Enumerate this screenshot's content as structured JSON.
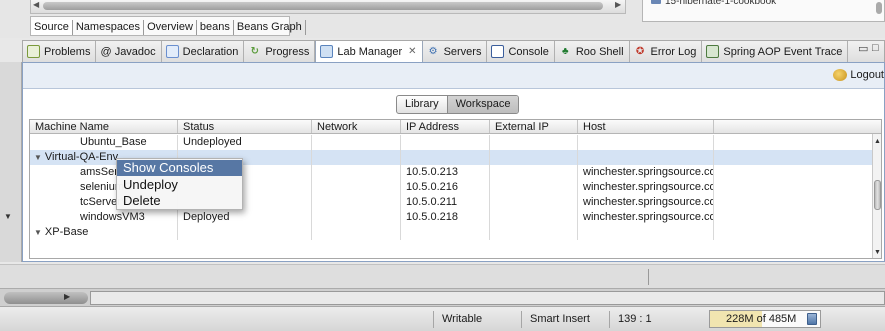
{
  "editor_tabs": {
    "items": [
      "Source",
      "Namespaces",
      "Overview",
      "beans",
      "Beans Graph"
    ],
    "active": "Source"
  },
  "outline": {
    "item": "15-hibernate-1-cookbook"
  },
  "views": {
    "tabs": [
      {
        "label": "Problems",
        "icon": "problems-icon"
      },
      {
        "label": "@ Javadoc",
        "icon": "javadoc-icon"
      },
      {
        "label": "Declaration",
        "icon": "declaration-icon"
      },
      {
        "label": "Progress",
        "icon": "progress-icon"
      },
      {
        "label": "Lab Manager",
        "icon": "lab-manager-icon",
        "active": true,
        "close": "✕"
      },
      {
        "label": "Servers",
        "icon": "servers-icon"
      },
      {
        "label": "Console",
        "icon": "console-icon"
      },
      {
        "label": "Roo Shell",
        "icon": "roo-shell-icon"
      },
      {
        "label": "Error Log",
        "icon": "error-log-icon"
      },
      {
        "label": "Spring AOP Event Trace",
        "icon": "spring-aop-icon"
      }
    ]
  },
  "lab_manager": {
    "logout_label": "Logout",
    "switcher": {
      "library": "Library",
      "workspace": "Workspace",
      "selected": "Workspace"
    },
    "columns": [
      "Machine Name",
      "Status",
      "Network",
      "IP Address",
      "External IP",
      "Host"
    ],
    "rows": [
      {
        "name": "Ubuntu_Base",
        "status": "Undeployed",
        "network": "",
        "ip": "",
        "external_ip": "",
        "host": ""
      },
      {
        "name": "Virtual-QA-Env",
        "group": true,
        "status": "",
        "network": "",
        "ip": "",
        "external_ip": "",
        "host": ""
      },
      {
        "name": "amsServer",
        "status": "",
        "network": "",
        "ip": "10.5.0.213",
        "external_ip": "",
        "host": "winchester.springsource.co"
      },
      {
        "name": "seleniumG",
        "status": "",
        "network": "",
        "ip": "10.5.0.216",
        "external_ip": "",
        "host": "winchester.springsource.co"
      },
      {
        "name": "tcServerVM",
        "status": "",
        "network": "",
        "ip": "10.5.0.211",
        "external_ip": "",
        "host": "winchester.springsource.co"
      },
      {
        "name": "windowsVM3",
        "status": "Deployed",
        "network": "",
        "ip": "10.5.0.218",
        "external_ip": "",
        "host": "winchester.springsource.co"
      },
      {
        "name": "XP-Base",
        "group": true,
        "status": "",
        "network": "",
        "ip": "",
        "external_ip": "",
        "host": ""
      }
    ],
    "context_menu": [
      "Show Consoles",
      "Undeploy",
      "Delete"
    ],
    "context_menu_highlighted": "Show Consoles"
  },
  "status_bar": {
    "writable": "Writable",
    "insert_mode": "Smart Insert",
    "position": "139 : 1",
    "heap_used": "228M",
    "heap_total": "of 485M",
    "heap_fraction": 0.47
  },
  "colors": {
    "selection": "#5777a4",
    "group_row": "#d5e3f4",
    "panel_border": "#8aa1c3"
  }
}
